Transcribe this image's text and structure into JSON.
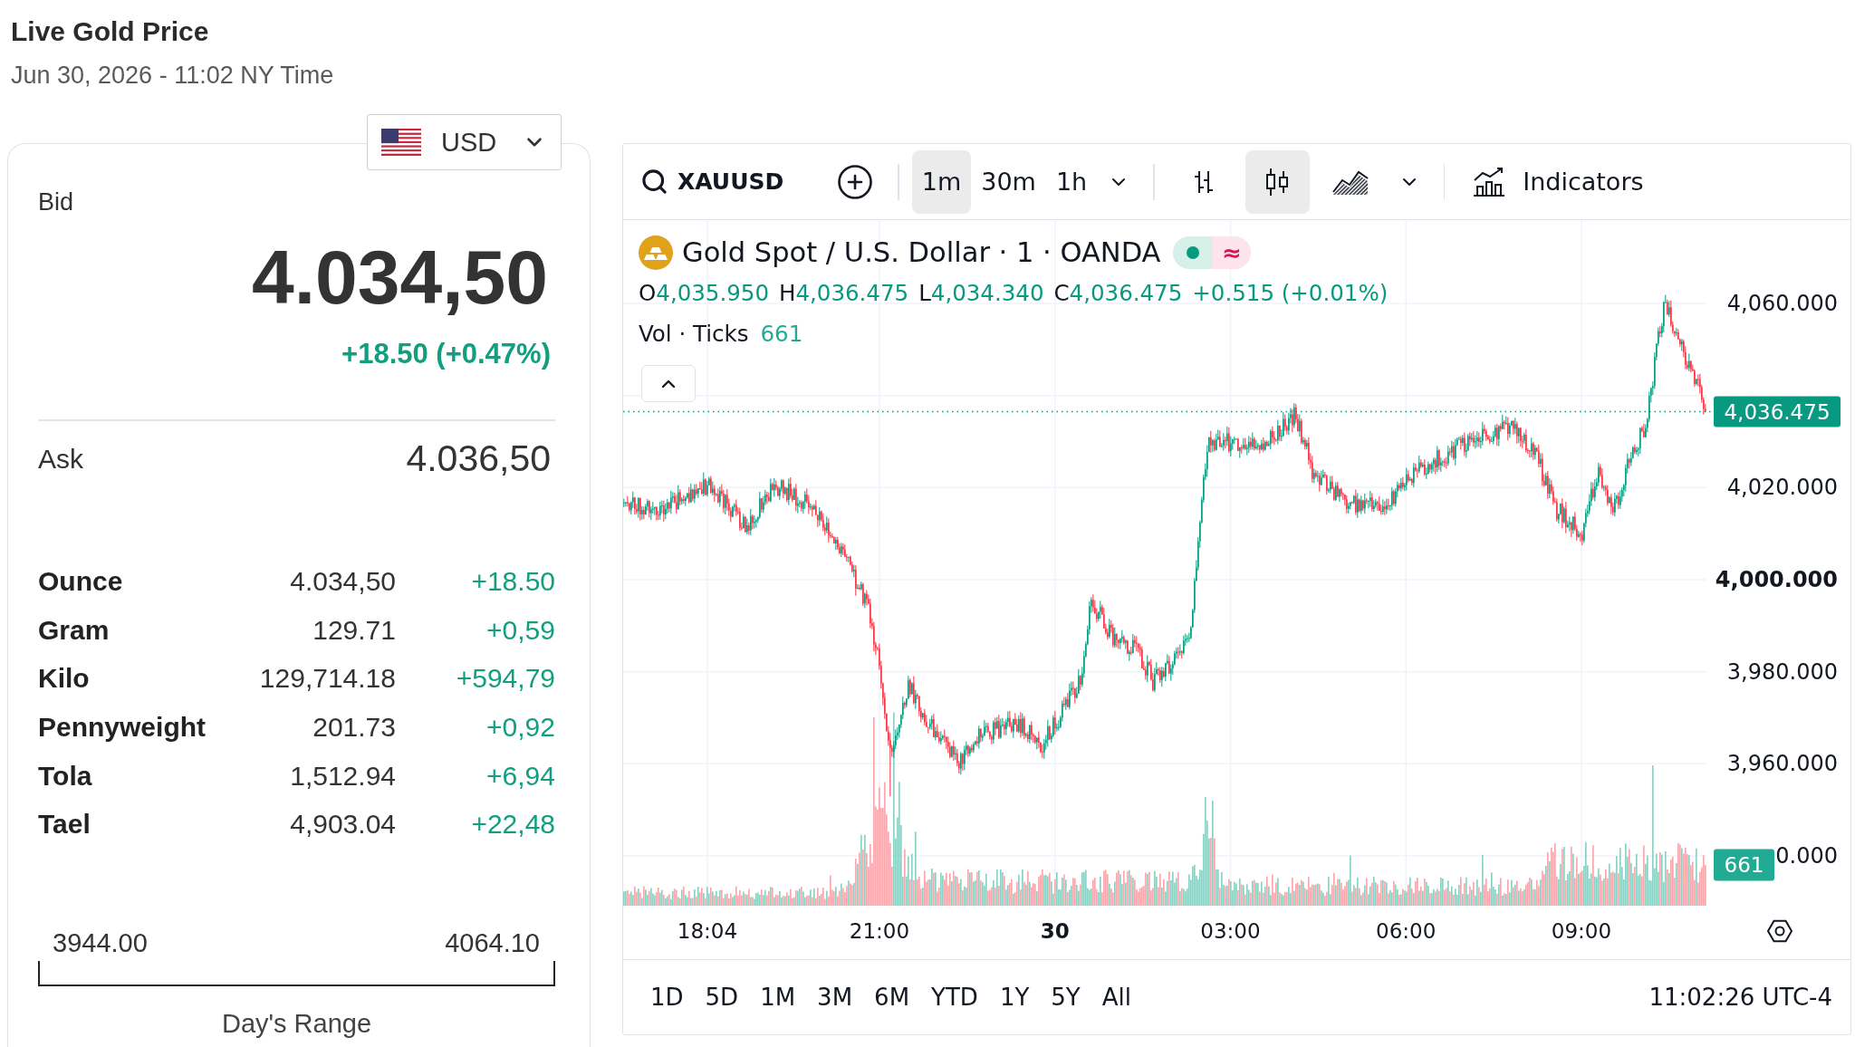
{
  "header": {
    "title": "Live Gold Price",
    "timestamp": "Jun 30, 2026 - 11:02 NY Time"
  },
  "currency": {
    "code": "USD"
  },
  "quote": {
    "bid_label": "Bid",
    "bid": "4.034,50",
    "change": "+18.50 (+0.47%)",
    "ask_label": "Ask",
    "ask": "4.036,50"
  },
  "units": [
    {
      "name": "Ounce",
      "price": "4.034,50",
      "change": "+18.50"
    },
    {
      "name": "Gram",
      "price": "129.71",
      "change": "+0,59"
    },
    {
      "name": "Kilo",
      "price": "129,714.18",
      "change": "+594,79"
    },
    {
      "name": "Pennyweight",
      "price": "201.73",
      "change": "+0,92"
    },
    {
      "name": "Tola",
      "price": "1,512.94",
      "change": "+6,94"
    },
    {
      "name": "Tael",
      "price": "4,903.04",
      "change": "+22,48"
    }
  ],
  "days_range": {
    "low": "3944.00",
    "high": "4064.10",
    "label": "Day's Range"
  },
  "chart": {
    "toolbar": {
      "symbol": "XAUUSD",
      "intervals": [
        {
          "label": "1m",
          "selected": true
        },
        {
          "label": "30m",
          "selected": false
        },
        {
          "label": "1h",
          "selected": false
        }
      ],
      "chart_types": [
        {
          "kind": "bars",
          "selected": false
        },
        {
          "kind": "candles",
          "selected": true
        },
        {
          "kind": "area",
          "selected": false
        }
      ],
      "indicators_label": "Indicators"
    },
    "legend": {
      "title": "Gold Spot / U.S. Dollar · 1 · OANDA",
      "status_glyph": "≈",
      "ohlc": [
        {
          "label": "O",
          "value": "4,035.950"
        },
        {
          "label": "H",
          "value": "4,036.475"
        },
        {
          "label": "L",
          "value": "4,034.340"
        },
        {
          "label": "C",
          "value": "4,036.475"
        }
      ],
      "change": "+0.515 (+0.01%)",
      "volume_label": "Vol · Ticks",
      "volume_value": "661"
    },
    "price_axis": [
      {
        "label": "4,060.000",
        "bold": false
      },
      {
        "label": "4,020.000",
        "bold": false
      },
      {
        "label": "4,000.000",
        "bold": true
      },
      {
        "label": "3,980.000",
        "bold": false
      },
      {
        "label": "3,960.000",
        "bold": false
      },
      {
        "label": "0.000",
        "bold": false
      }
    ],
    "time_axis": [
      {
        "label": "18:04",
        "bold": false
      },
      {
        "label": "21:00",
        "bold": false
      },
      {
        "label": "30",
        "bold": true
      },
      {
        "label": "03:00",
        "bold": false
      },
      {
        "label": "06:00",
        "bold": false
      },
      {
        "label": "09:00",
        "bold": false
      }
    ],
    "last_price": "4,036.475",
    "last_volume": "661",
    "ranges": [
      {
        "label": "1D",
        "selected": false
      },
      {
        "label": "5D",
        "selected": false
      },
      {
        "label": "1M",
        "selected": false
      },
      {
        "label": "3M",
        "selected": false
      },
      {
        "label": "6M",
        "selected": false
      },
      {
        "label": "YTD",
        "selected": false
      },
      {
        "label": "1Y",
        "selected": false
      },
      {
        "label": "5Y",
        "selected": false
      },
      {
        "label": "All",
        "selected": false
      }
    ],
    "clock": "11:02:26 UTC-4"
  }
}
